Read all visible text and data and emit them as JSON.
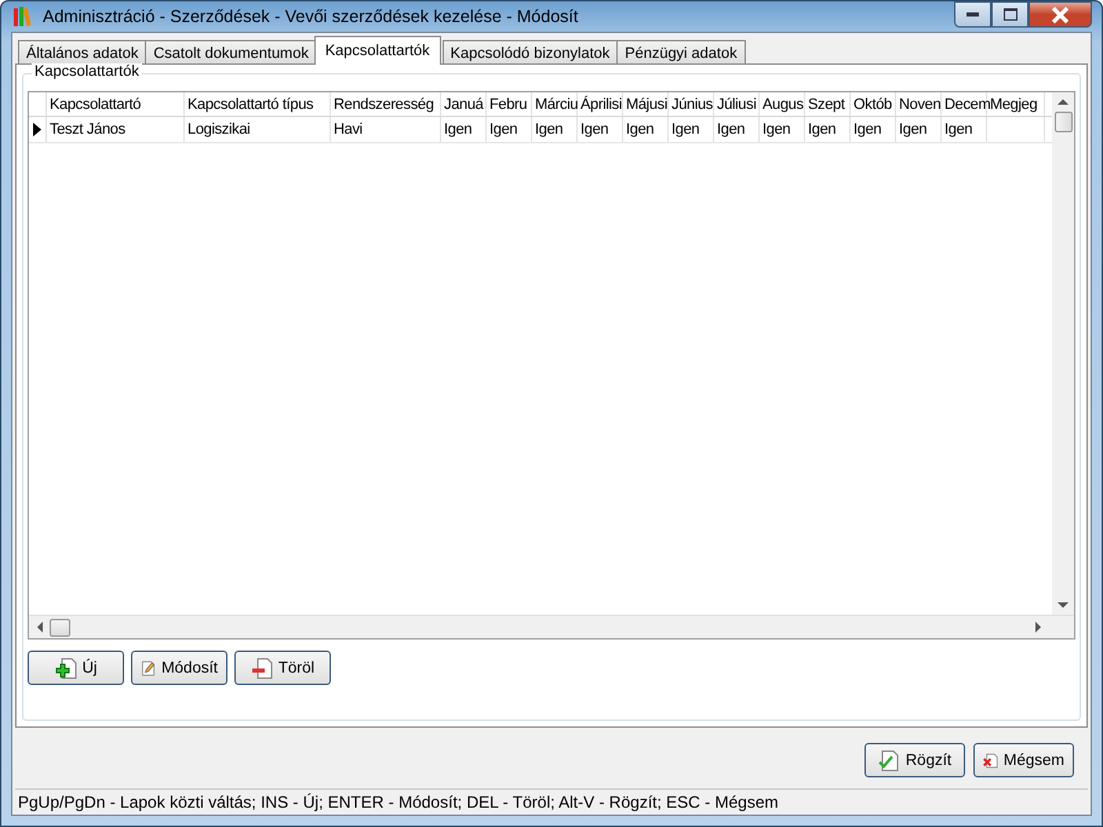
{
  "window": {
    "title": "Adminisztráció - Szerződések - Vevői szerződések kezelése - Módosít"
  },
  "tabs": [
    {
      "label": "Általános adatok",
      "selected": false
    },
    {
      "label": "Csatolt dokumentumok",
      "selected": false
    },
    {
      "label": "Kapcsolattartók",
      "selected": true
    },
    {
      "label": "Kapcsolódó bizonylatok",
      "selected": false
    },
    {
      "label": "Pénzügyi adatok",
      "selected": false
    }
  ],
  "group": {
    "title": "Kapcsolattartók"
  },
  "grid": {
    "columns": [
      "Kapcsolattartó",
      "Kapcsolattartó típus",
      "Rendszeresség",
      "Januá",
      "Febru",
      "Márciu",
      "Áprilisi",
      "Májusi",
      "Június",
      "Júliusi",
      "Augus",
      "Szept",
      "Októb",
      "Noven",
      "Decem",
      "Megjeg"
    ],
    "rows": [
      {
        "selected": true,
        "cells": [
          "Teszt János",
          "Logiszikai",
          "Havi",
          "Igen",
          "Igen",
          "Igen",
          "Igen",
          "Igen",
          "Igen",
          "Igen",
          "Igen",
          "Igen",
          "Igen",
          "Igen",
          "Igen",
          ""
        ]
      }
    ]
  },
  "actions": [
    {
      "label": "Új",
      "kind": "new"
    },
    {
      "label": "Módosít",
      "kind": "edit"
    },
    {
      "label": "Töröl",
      "kind": "delete"
    }
  ],
  "dialog_buttons": [
    {
      "label": "Rögzít",
      "kind": "save"
    },
    {
      "label": "Mégsem",
      "kind": "cancel"
    }
  ],
  "status_bar": "PgUp/PgDn - Lapok közti váltás; INS - Új; ENTER - Módosít; DEL - Töröl; Alt-V - Rögzít; ESC - Mégsem"
}
